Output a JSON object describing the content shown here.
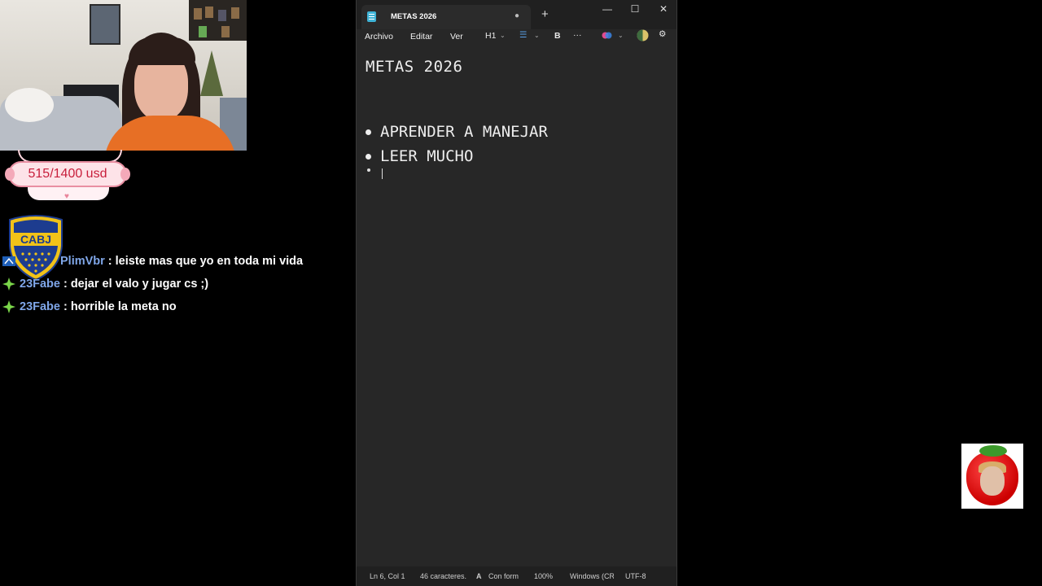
{
  "goal": {
    "text": "515/1400 usd"
  },
  "chat": {
    "messages": [
      {
        "user": "PlimVbr",
        "separator": ":",
        "text": "leiste mas que yo en toda mi vida"
      },
      {
        "user": "23Fabe",
        "separator": ":",
        "text": "dejar el valo y jugar cs ;)"
      },
      {
        "user": "23Fabe",
        "separator": ":",
        "text": "horrible la meta no"
      }
    ],
    "shield_text": "CABJ"
  },
  "notepad": {
    "tab_title": "METAS 2026",
    "new_tab": "+",
    "window_controls": {
      "minimize": "—",
      "maximize": "☐",
      "close": "✕"
    },
    "menu": [
      "Archivo",
      "Editar",
      "Ver"
    ],
    "toolbar": {
      "heading": "H1",
      "bold": "B",
      "more": "···"
    },
    "document": {
      "heading": "METAS 2026",
      "bullets": [
        "APRENDER A MANEJAR",
        "LEER MUCHO"
      ]
    },
    "status": {
      "position": "Ln 6, Col 1",
      "chars": "46 caracteres.",
      "format": "Con form",
      "zoom": "100%",
      "line_ending": "Windows (CR",
      "encoding": "UTF-8"
    }
  },
  "colors": {
    "username": "#7fa6e8",
    "badge_green": "#7bd64a",
    "goal_text": "#c81e3b",
    "notepad_bg": "#272727",
    "boca_blue": "#1d3c8f",
    "boca_gold": "#f2c318"
  }
}
